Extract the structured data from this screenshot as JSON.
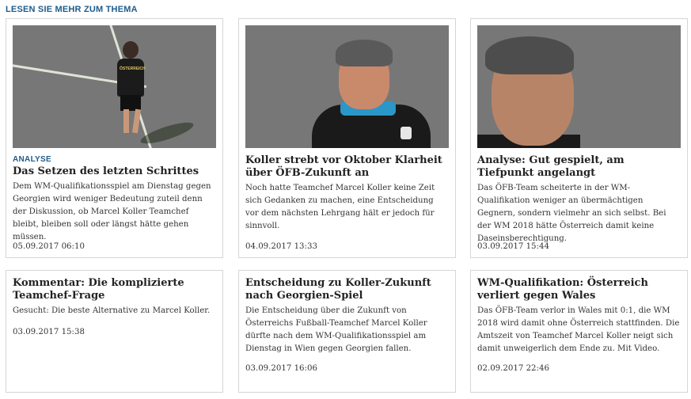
{
  "section": {
    "title": "LESEN SIE MEHR ZUM THEMA"
  },
  "articles": [
    {
      "kicker": "ANALYSE",
      "title": "Das Setzen des letzten Schrittes",
      "teaser": "Dem WM-Qualifikationsspiel am Dienstag gegen Georgien wird weniger Bedeutung zuteil denn der Diskussion, ob Marcel Koller Teamchef bleibt, bleiben soll oder längst hätte gehen müssen.",
      "date": "05.09.2017 06:10",
      "image_text": "ÖSTERREICH"
    },
    {
      "title": "Koller strebt vor Oktober Klarheit über ÖFB-Zukunft an",
      "teaser": "Noch hatte Teamchef Marcel Koller keine Zeit sich Gedanken zu machen, eine Entscheidung vor dem nächsten Lehrgang hält er jedoch für sinnvoll.",
      "date": "04.09.2017 13:33"
    },
    {
      "title": "Analyse: Gut gespielt, am Tiefpunkt angelangt",
      "teaser": "Das ÖFB-Team scheiterte in der WM-Qualifikation weniger an übermächtigen Gegnern, sondern vielmehr an sich selbst. Bei der WM 2018 hätte Österreich damit keine Daseinsberechtigung.",
      "date": "03.09.2017 15:44"
    },
    {
      "title": "Kommentar: Die komplizierte Teamchef-Frage",
      "teaser": "Gesucht: Die beste Alternative zu Marcel Koller.",
      "date": "03.09.2017 15:38"
    },
    {
      "title": "Entscheidung zu Koller-Zukunft nach Georgien-Spiel",
      "teaser": "Die Entscheidung über die Zukunft von Österreichs Fußball-Teamchef Marcel Koller dürfte nach dem WM-Qualifikationsspiel am Dienstag in Wien gegen Georgien fallen.",
      "date": "03.09.2017 16:06"
    },
    {
      "title": "WM-Qualifikation: Österreich verliert gegen Wales",
      "teaser": "Das ÖFB-Team verlor in Wales mit 0:1, die WM 2018 wird damit ohne Österreich stattfinden. Die Amtszeit von Teamchef Marcel Koller neigt sich damit unweigerlich dem Ende zu. Mit Video.",
      "date": "02.09.2017 22:46"
    }
  ],
  "colors": {
    "accent": "#1f5c8c",
    "border": "#d6d6d6"
  }
}
